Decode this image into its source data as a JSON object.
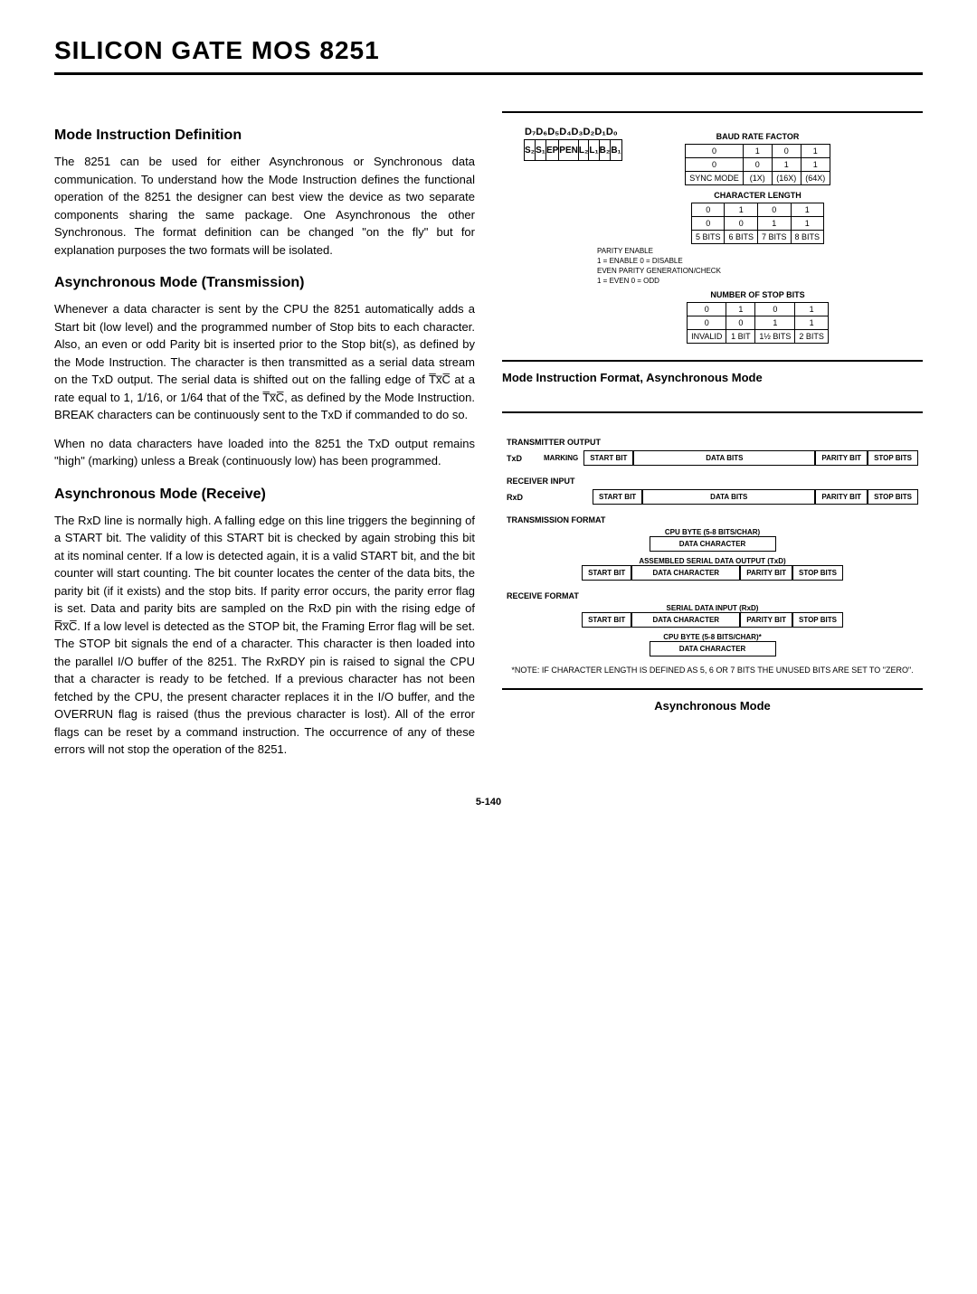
{
  "page": {
    "title": "SILICON GATE MOS 8251",
    "pagenum": "5-140"
  },
  "left": {
    "h1": "Mode Instruction Definition",
    "p1": "The 8251 can be used for either Asynchronous or Synchronous data communication. To understand how the Mode Instruction defines the functional operation of the 8251 the designer can best view the device as two separate components sharing the same package. One Asynchronous the other Synchronous. The format definition can be changed \"on the fly\" but for explanation purposes the two formats will be isolated.",
    "h2": "Asynchronous Mode (Transmission)",
    "p2a": "Whenever a data character is sent by the CPU the 8251 automatically adds a Start bit (low level) and the programmed number of Stop bits to each character. Also, an even or odd Parity bit is inserted prior to the Stop bit(s), as defined by the Mode Instruction. The character is then transmitted as a serial data stream on the TxD output. The serial data is shifted out on the falling edge of T̅x̅C̅ at a rate equal to 1, 1/16, or 1/64 that of the T̅x̅C̅, as defined by the Mode Instruction. BREAK characters can be continuously sent to the TxD if commanded to do so.",
    "p2b": "When no data characters have loaded into the 8251 the TxD output remains \"high\" (marking) unless a Break (continuously low) has been programmed.",
    "h3": "Asynchronous Mode (Receive)",
    "p3": "The RxD line is normally high. A falling edge on this line triggers the beginning of a START bit. The validity of this START bit is checked by again strobing this bit at its nominal center. If a low is detected again, it is a valid START bit, and the bit counter will start counting. The bit counter locates the center of the data bits, the parity bit (if it exists) and the stop bits. If parity error occurs, the parity error flag is set. Data and parity bits are sampled on the RxD pin with the rising edge of R̅x̅C̅. If a low level is detected as the STOP bit, the Framing Error flag will be set. The STOP bit signals the end of a character. This character is then loaded into the parallel I/O buffer of the 8251. The RxRDY pin is raised to signal the CPU that a character is ready to be fetched. If a previous character has not been fetched by the CPU, the present character replaces it in the I/O buffer, and the OVERRUN flag is raised (thus the previous character is lost). All of the error flags can be reset by a command instruction. The occurrence of any of these errors will not stop the operation of the 8251."
  },
  "mode_diagram": {
    "bits": [
      "D₇",
      "D₆",
      "D₅",
      "D₄",
      "D₃",
      "D₂",
      "D₁",
      "D₀"
    ],
    "fields": [
      "S₂",
      "S₁",
      "EP",
      "PEN",
      "L₂",
      "L₁",
      "B₂",
      "B₁"
    ],
    "baud_label": "BAUD RATE FACTOR",
    "baud_r1": [
      "0",
      "1",
      "0",
      "1"
    ],
    "baud_r2": [
      "0",
      "0",
      "1",
      "1"
    ],
    "baud_r3": [
      "SYNC MODE",
      "(1X)",
      "(16X)",
      "(64X)"
    ],
    "char_label": "CHARACTER LENGTH",
    "char_r1": [
      "0",
      "1",
      "0",
      "1"
    ],
    "char_r2": [
      "0",
      "0",
      "1",
      "1"
    ],
    "char_r3": [
      "5 BITS",
      "6 BITS",
      "7 BITS",
      "8 BITS"
    ],
    "parity1": "PARITY ENABLE",
    "parity2": "1 = ENABLE   0 = DISABLE",
    "parity3": "EVEN PARITY GENERATION/CHECK",
    "parity4": "1 = EVEN   0 = ODD",
    "stop_label": "NUMBER OF STOP BITS",
    "stop_r1": [
      "0",
      "1",
      "0",
      "1"
    ],
    "stop_r2": [
      "0",
      "0",
      "1",
      "1"
    ],
    "stop_r3": [
      "INVALID",
      "1 BIT",
      "1½ BITS",
      "2 BITS"
    ],
    "caption": "Mode Instruction Format, Asynchronous Mode"
  },
  "timing": {
    "tx_label": "TRANSMITTER OUTPUT",
    "txd": "TxD",
    "marking": "MARKING",
    "start_bit": "START BIT",
    "data_bits": "DATA BITS",
    "parity_bit": "PARITY BIT",
    "stop_bits": "STOP BITS",
    "rx_label": "RECEIVER INPUT",
    "rxd": "RxD",
    "tf_label": "TRANSMISSION FORMAT",
    "cpu_byte": "CPU BYTE (5-8 BITS/CHAR)",
    "data_char": "DATA CHARACTER",
    "asm_out": "ASSEMBLED SERIAL DATA OUTPUT (TxD)",
    "rf_label": "RECEIVE FORMAT",
    "serial_in": "SERIAL DATA INPUT (RxD)",
    "cpu_byte2": "CPU BYTE (5-8 BITS/CHAR)*",
    "note": "*NOTE: IF CHARACTER LENGTH IS DEFINED AS 5, 6 OR 7 BITS THE UNUSED BITS ARE SET TO \"ZERO\".",
    "caption": "Asynchronous Mode"
  }
}
